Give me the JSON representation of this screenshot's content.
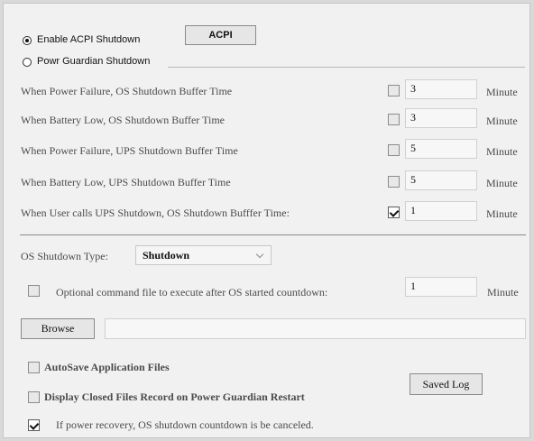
{
  "shutdown_method": {
    "enable_acpi": "Enable ACPI Shutdown",
    "acpi_button": "ACPI",
    "power_guardian": "Powr Guardian Shutdown"
  },
  "settings": [
    {
      "label": "When Power Failure, OS Shutdown Buffer Time",
      "checked": false,
      "value": "3",
      "unit": "Minute"
    },
    {
      "label": "When Battery Low, OS Shutdown Buffer Time",
      "checked": false,
      "value": "3",
      "unit": "Minute"
    },
    {
      "label": "When Power Failure, UPS Shutdown Buffer Time",
      "checked": false,
      "value": "5",
      "unit": "Minute"
    },
    {
      "label": "When Battery Low, UPS Shutdown Buffer Time",
      "checked": false,
      "value": "5",
      "unit": "Minute"
    },
    {
      "label": "When User calls UPS Shutdown, OS Shutdown Bufffer Time:",
      "checked": true,
      "value": "1",
      "unit": "Minute"
    }
  ],
  "os_shutdown": {
    "type_label": "OS Shutdown Type:",
    "type_value": "Shutdown",
    "optional_label": "Optional command file to execute after OS started countdown:",
    "optional_checked": false,
    "optional_value": "1",
    "optional_unit": "Minute"
  },
  "browse": {
    "button_label": "Browse",
    "path_value": ""
  },
  "bottom": {
    "autosave_label": "AutoSave Application Files",
    "display_closed_label": "Display Closed Files Record on Power Guardian Restart",
    "saved_log_label": "Saved Log",
    "recovery_label": "If power recovery, OS shutdown countdown is be canceled.",
    "recovery_checked": true
  },
  "icons": {
    "selected_radio": "selected-radio-icon",
    "radio": "radio-icon",
    "checkbox": "checkbox-icon",
    "dropdown": "chevron-down-icon"
  },
  "colors": {
    "panel_background": "#f1f1f1",
    "text": "#4b4b4b",
    "button_background": "#e6e6e6"
  }
}
